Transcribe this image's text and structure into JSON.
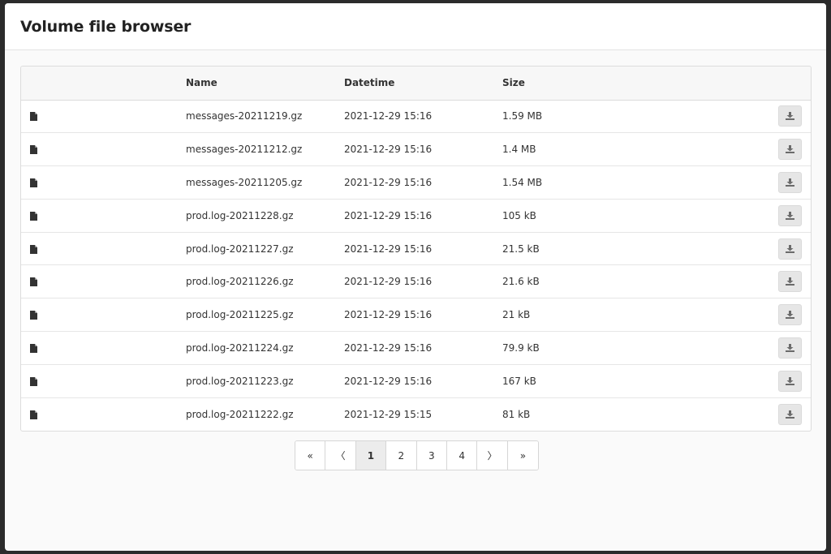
{
  "header": {
    "title": "Volume file browser"
  },
  "table": {
    "columns": {
      "name": "Name",
      "datetime": "Datetime",
      "size": "Size"
    },
    "rows": [
      {
        "name": "messages-20211219.gz",
        "datetime": "2021-12-29 15:16",
        "size": "1.59 MB"
      },
      {
        "name": "messages-20211212.gz",
        "datetime": "2021-12-29 15:16",
        "size": "1.4 MB"
      },
      {
        "name": "messages-20211205.gz",
        "datetime": "2021-12-29 15:16",
        "size": "1.54 MB"
      },
      {
        "name": "prod.log-20211228.gz",
        "datetime": "2021-12-29 15:16",
        "size": "105 kB"
      },
      {
        "name": "prod.log-20211227.gz",
        "datetime": "2021-12-29 15:16",
        "size": "21.5 kB"
      },
      {
        "name": "prod.log-20211226.gz",
        "datetime": "2021-12-29 15:16",
        "size": "21.6 kB"
      },
      {
        "name": "prod.log-20211225.gz",
        "datetime": "2021-12-29 15:16",
        "size": "21 kB"
      },
      {
        "name": "prod.log-20211224.gz",
        "datetime": "2021-12-29 15:16",
        "size": "79.9 kB"
      },
      {
        "name": "prod.log-20211223.gz",
        "datetime": "2021-12-29 15:16",
        "size": "167 kB"
      },
      {
        "name": "prod.log-20211222.gz",
        "datetime": "2021-12-29 15:15",
        "size": "81 kB"
      }
    ],
    "row_icon": "file-icon",
    "action_icon": "download-icon"
  },
  "pagination": {
    "first": "«",
    "prev": "〈",
    "pages": [
      "1",
      "2",
      "3",
      "4"
    ],
    "current": "1",
    "next": "〉",
    "last": "»"
  },
  "colors": {
    "icon": "#333333",
    "download_icon": "#6b6b6b",
    "button_bg": "#e6e6e6"
  }
}
